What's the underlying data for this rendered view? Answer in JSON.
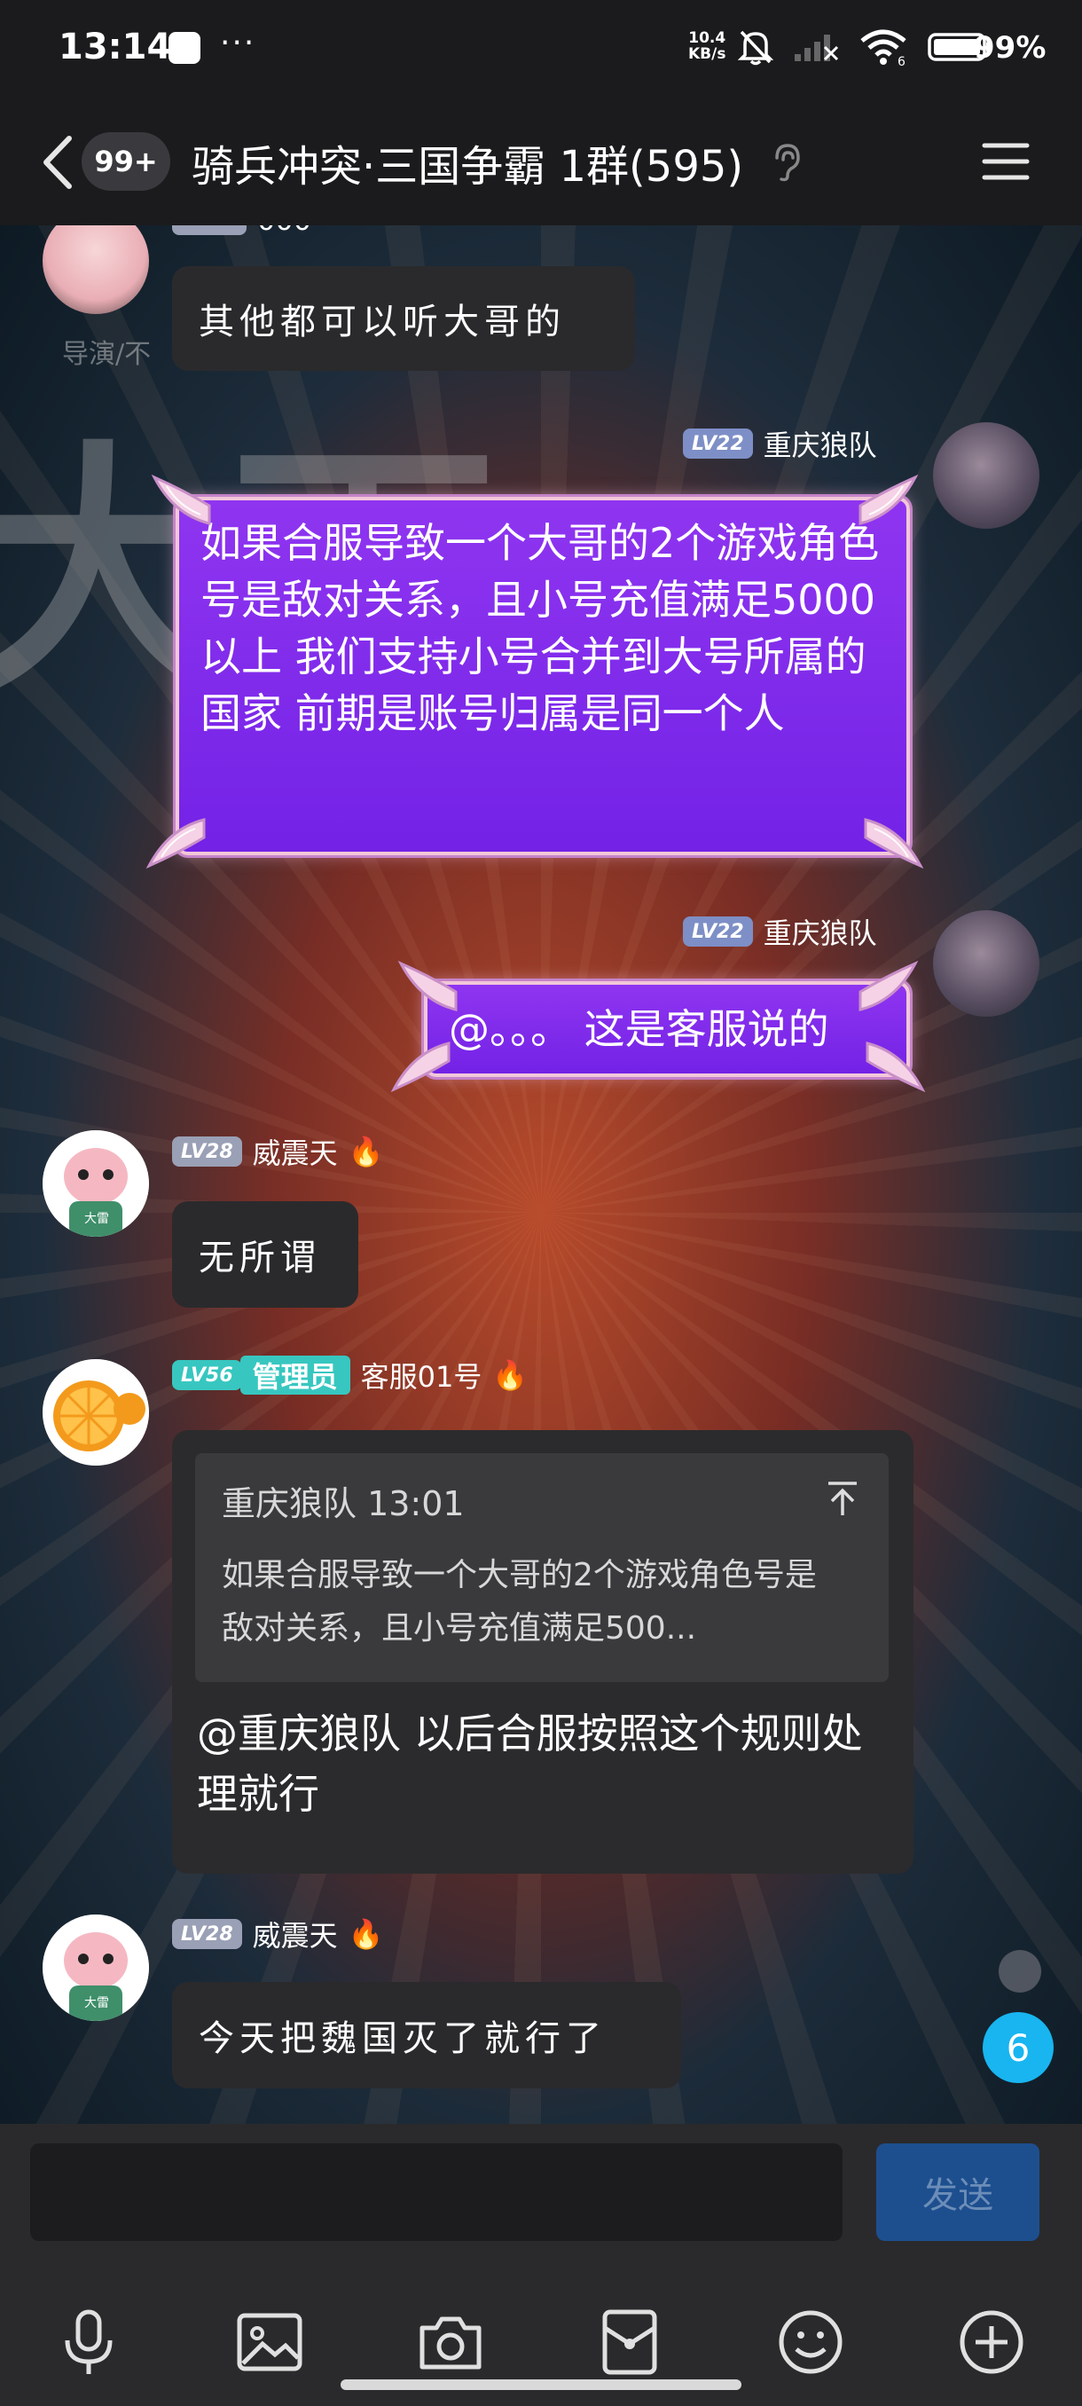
{
  "status_bar": {
    "time": "13:14",
    "dots": "···",
    "net_speed_value": "10.4",
    "net_speed_unit": "KB/s",
    "wifi_sub": "6",
    "battery": "99%"
  },
  "header": {
    "unread_count": "99+",
    "title": "骑兵冲突·三国争霸 1群(595)"
  },
  "background": {
    "small_text": "导演/不",
    "big_text": "大雨"
  },
  "messages": [
    {
      "kind": "partial",
      "partial_name": "000",
      "text": "其他都可以听大哥的"
    },
    {
      "kind": "self",
      "level": "LV22",
      "sender": "重庆狼队",
      "text": "如果合服导致一个大哥的2个游戏角色号是敌对关系，且小号充值满足5000以上 我们支持小号合并到大号所属的国家  前期是账号归属是同一个人"
    },
    {
      "kind": "self",
      "level": "LV22",
      "sender": "重庆狼队",
      "text": "@。。。  这是客服说的"
    },
    {
      "kind": "other",
      "level": "LV28",
      "sender": "威震天",
      "fire": "🔥",
      "text": "无所谓"
    },
    {
      "kind": "reply",
      "level": "LV56",
      "role": "管理员",
      "sender": "客服01号",
      "fire": "🔥",
      "quote_header": "重庆狼队 13:01",
      "quote_text": "如果合服导致一个大哥的2个游戏角色号是敌对关系，且小号充值满足500...",
      "text": "@重庆狼队 以后合服按照这个规则处理就行"
    },
    {
      "kind": "other",
      "level": "LV28",
      "sender": "威震天",
      "fire": "🔥",
      "text": "今天把魏国灭了就行了"
    }
  ],
  "unread_badge": "6",
  "input": {
    "send_label": "发送"
  },
  "avatar_text": {
    "pig_tag": "大雷"
  }
}
